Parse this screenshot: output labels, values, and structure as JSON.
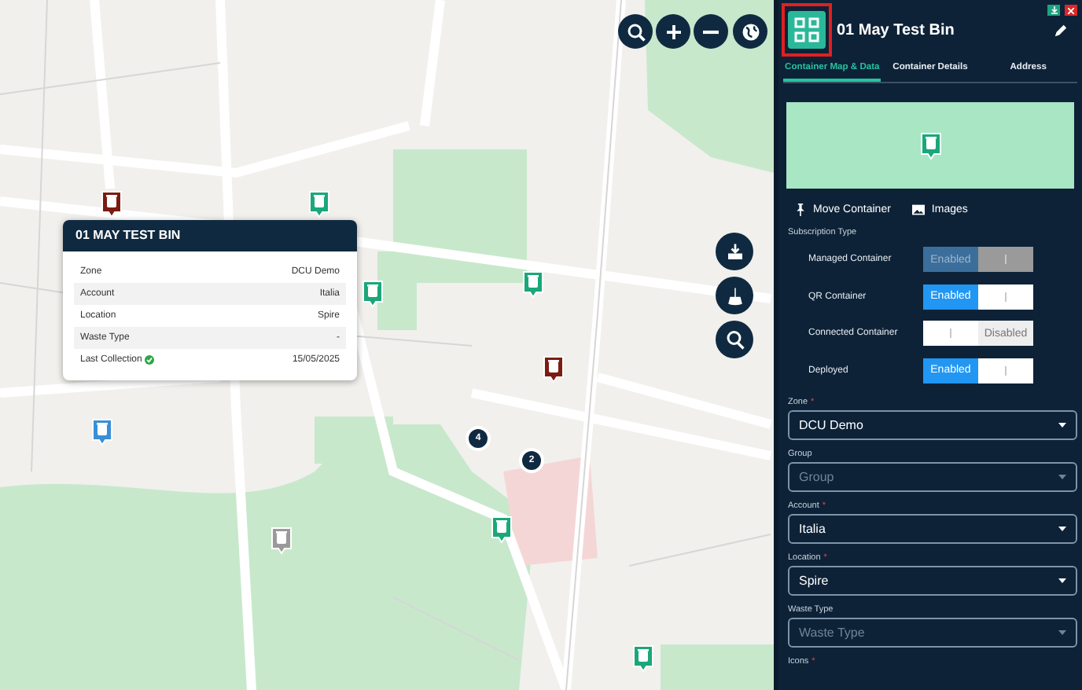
{
  "map": {
    "clusters": [
      {
        "count": "4"
      },
      {
        "count": "2"
      }
    ]
  },
  "popup": {
    "title": "01 MAY TEST BIN",
    "rows": [
      {
        "label": "Zone",
        "value": "DCU Demo",
        "verified": false
      },
      {
        "label": "Account",
        "value": "Italia",
        "verified": false
      },
      {
        "label": "Location",
        "value": "Spire",
        "verified": false
      },
      {
        "label": "Waste Type",
        "value": "-",
        "verified": false
      },
      {
        "label": "Last Collection",
        "value": "15/05/2025",
        "verified": true
      }
    ]
  },
  "panel": {
    "title": "01 May Test Bin",
    "tabs": [
      {
        "label": "Container Map & Data",
        "selected": true
      },
      {
        "label": "Container Details",
        "selected": false
      },
      {
        "label": "Address",
        "selected": false
      }
    ],
    "actions": [
      {
        "label": "Move Container",
        "kind": "pin"
      },
      {
        "label": "Images",
        "kind": "image"
      }
    ],
    "subscription_label": "Subscription Type",
    "toggles": [
      {
        "label": "Managed Container",
        "text": "Enabled",
        "on": true,
        "disabled": true
      },
      {
        "label": "QR Container",
        "text": "Enabled",
        "on": true,
        "disabled": false
      },
      {
        "label": "Connected Container",
        "text": "Disabled",
        "on": false,
        "disabled": false
      },
      {
        "label": "Deployed",
        "text": "Enabled",
        "on": true,
        "disabled": false
      }
    ],
    "fields": [
      {
        "label": "Zone",
        "required_mark": "*",
        "value": "DCU Demo"
      },
      {
        "label": "Group",
        "placeholder": "Group"
      },
      {
        "label": "Account",
        "required_mark": "*",
        "value": "Italia"
      },
      {
        "label": "Location",
        "required_mark": "*",
        "value": "Spire"
      },
      {
        "label": "Waste Type",
        "placeholder": "Waste Type"
      },
      {
        "label": "Icons",
        "required_mark": "*"
      }
    ]
  }
}
